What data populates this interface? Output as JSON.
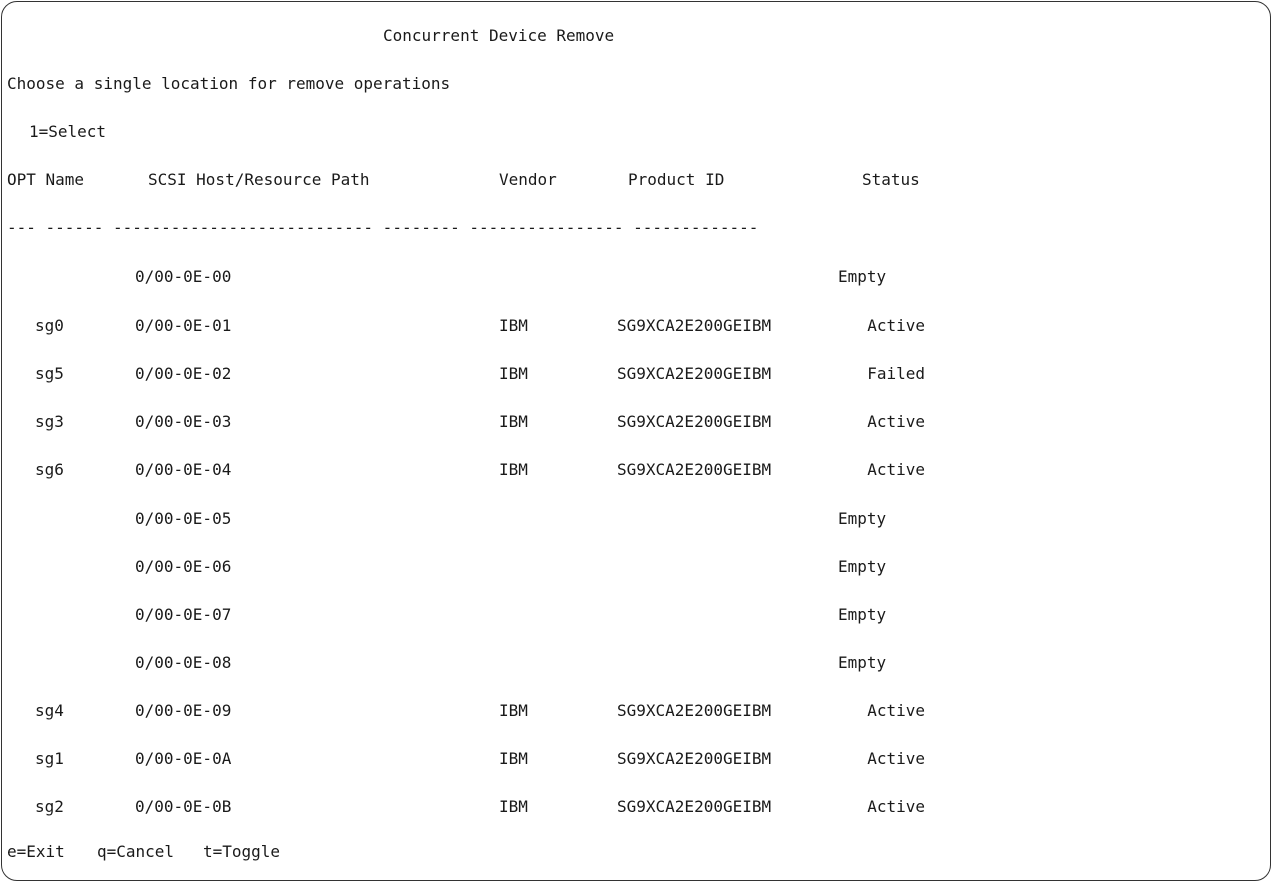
{
  "screen": {
    "title": "Concurrent Device Remove",
    "instruction": "Choose a single location for remove operations",
    "option_legend": "1=Select"
  },
  "table": {
    "headers": {
      "opt_name": "OPT Name",
      "path": "SCSI Host/Resource Path",
      "vendor": "Vendor",
      "product": "Product ID",
      "status": "Status"
    },
    "separator": "--- ------ --------------------------- -------- ---------------- -------------",
    "rows": [
      {
        "name": "",
        "path": "0/00-0E-00",
        "vendor": "",
        "product": "",
        "status": "Empty"
      },
      {
        "name": "sg0",
        "path": "0/00-0E-01",
        "vendor": "IBM",
        "product": "SG9XCA2E200GEIBM",
        "status": "Active"
      },
      {
        "name": "sg5",
        "path": "0/00-0E-02",
        "vendor": "IBM",
        "product": "SG9XCA2E200GEIBM",
        "status": "Failed"
      },
      {
        "name": "sg3",
        "path": "0/00-0E-03",
        "vendor": "IBM",
        "product": "SG9XCA2E200GEIBM",
        "status": "Active"
      },
      {
        "name": "sg6",
        "path": "0/00-0E-04",
        "vendor": "IBM",
        "product": "SG9XCA2E200GEIBM",
        "status": "Active"
      },
      {
        "name": "",
        "path": "0/00-0E-05",
        "vendor": "",
        "product": "",
        "status": "Empty"
      },
      {
        "name": "",
        "path": "0/00-0E-06",
        "vendor": "",
        "product": "",
        "status": "Empty"
      },
      {
        "name": "",
        "path": "0/00-0E-07",
        "vendor": "",
        "product": "",
        "status": "Empty"
      },
      {
        "name": "",
        "path": "0/00-0E-08",
        "vendor": "",
        "product": "",
        "status": "Empty"
      },
      {
        "name": "sg4",
        "path": "0/00-0E-09",
        "vendor": "IBM",
        "product": "SG9XCA2E200GEIBM",
        "status": "Active"
      },
      {
        "name": "sg1",
        "path": "0/00-0E-0A",
        "vendor": "IBM",
        "product": "SG9XCA2E200GEIBM",
        "status": "Active"
      },
      {
        "name": "sg2",
        "path": "0/00-0E-0B",
        "vendor": "IBM",
        "product": "SG9XCA2E200GEIBM",
        "status": "Active"
      }
    ]
  },
  "footer": {
    "keys": [
      "e=Exit",
      "q=Cancel",
      "t=Toggle"
    ]
  }
}
